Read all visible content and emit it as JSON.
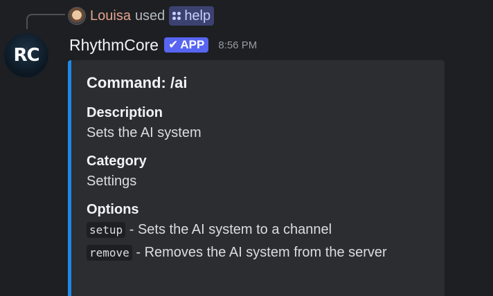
{
  "reply": {
    "user": "Louisa",
    "used": "used",
    "command": "help"
  },
  "bot": {
    "avatar_text": "RC",
    "name": "RhythmCore",
    "badge": "APP",
    "timestamp": "8:56 PM"
  },
  "embed": {
    "accent_color": "#1e88e5",
    "title": "Command: /ai",
    "fields": [
      {
        "name": "Description",
        "value": "Sets the AI system"
      },
      {
        "name": "Category",
        "value": "Settings"
      }
    ],
    "options": {
      "name": "Options",
      "items": [
        {
          "code": "setup",
          "text": " - Sets the AI system to a channel"
        },
        {
          "code": "remove",
          "text": " - Removes the AI system from the server"
        }
      ]
    }
  }
}
